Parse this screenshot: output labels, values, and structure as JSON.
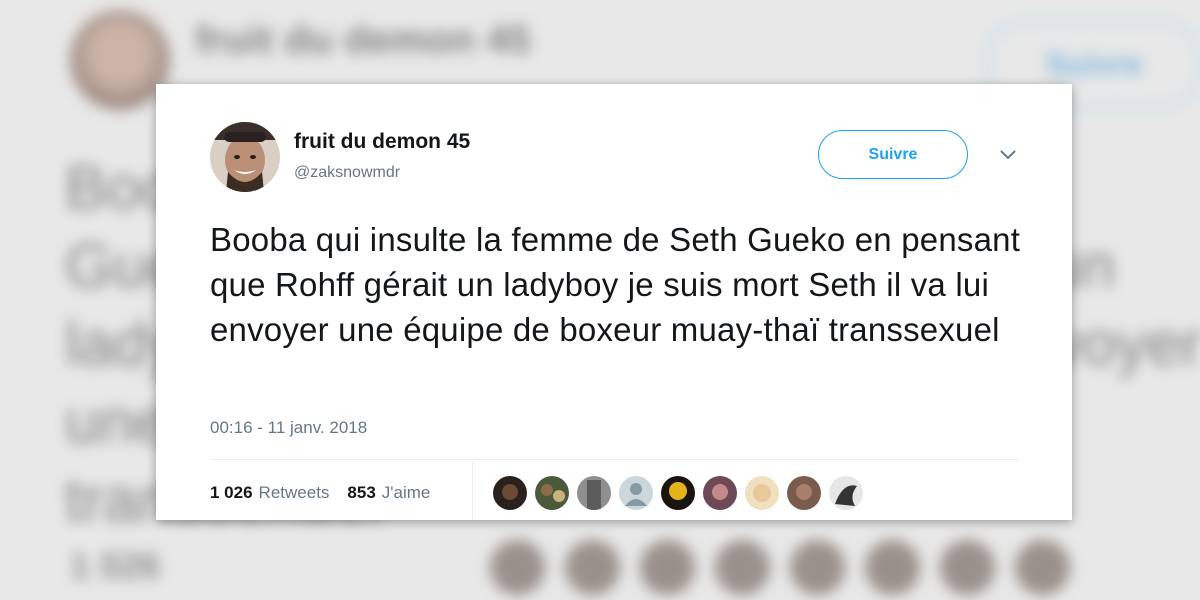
{
  "tweet": {
    "display_name": "fruit du demon 45",
    "handle": "@zaksnowmdr",
    "follow_label": "Suivre",
    "text": "Booba qui insulte la femme de Seth Gueko en pensant que Rohff gérait un ladyboy je suis mort Seth il va lui envoyer une équipe de boxeur muay-thaï transsexuel",
    "timestamp": "00:16 - 11 janv. 2018",
    "retweets_count": "1 026",
    "retweets_label": "Retweets",
    "likes_count": "853",
    "likes_label": "J'aime",
    "likers": [
      {
        "icon": "avatar-dark"
      },
      {
        "icon": "avatar-green"
      },
      {
        "icon": "avatar-grey"
      },
      {
        "icon": "avatar-default-silhouette"
      },
      {
        "icon": "avatar-yellow"
      },
      {
        "icon": "avatar-pink"
      },
      {
        "icon": "avatar-light"
      },
      {
        "icon": "avatar-brown"
      },
      {
        "icon": "avatar-bw"
      }
    ]
  },
  "colors": {
    "accent": "#1da1f2",
    "text": "#14171a",
    "secondary": "#657786"
  }
}
